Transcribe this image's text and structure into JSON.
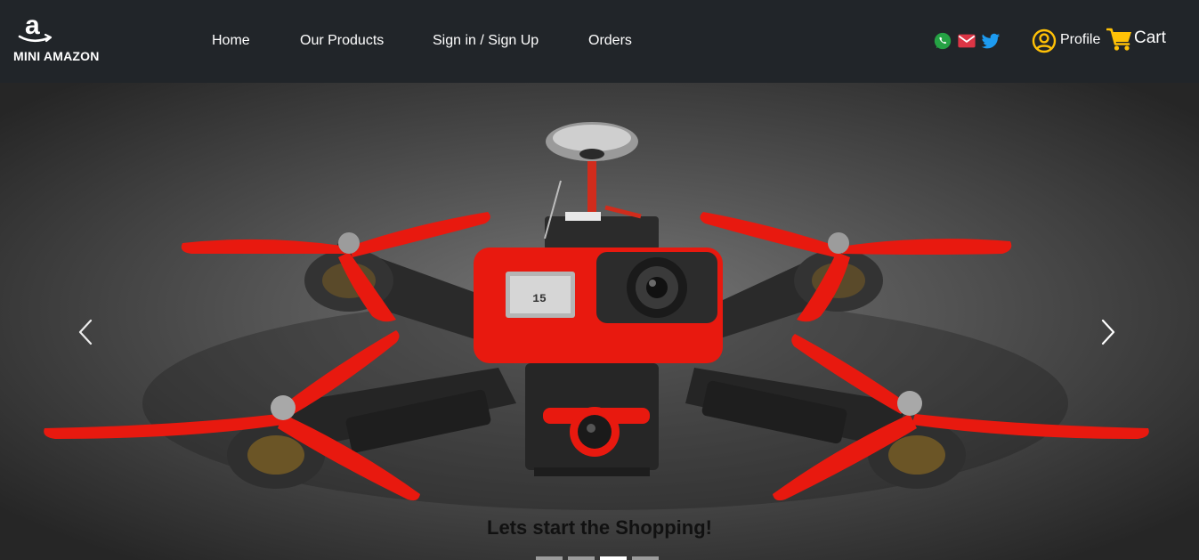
{
  "brand": {
    "name": "MINI AMAZON",
    "logo_icon": "amazon-logo-icon"
  },
  "nav": {
    "items": [
      {
        "label": "Home"
      },
      {
        "label": "Our Products"
      },
      {
        "label": "Sign in / Sign Up"
      },
      {
        "label": "Orders"
      }
    ]
  },
  "social": {
    "whatsapp_icon": "whatsapp-icon",
    "mail_icon": "mail-icon",
    "twitter_icon": "twitter-icon",
    "colors": {
      "whatsapp": "#25a244",
      "mail": "#dc3545",
      "twitter": "#1d9bf0"
    }
  },
  "profile": {
    "label": "Profile",
    "icon": "user-circle-icon"
  },
  "cart": {
    "label": "Cart",
    "icon": "shopping-cart-icon"
  },
  "colors": {
    "navbar": "#212529",
    "accent": "#ffc107",
    "drone": "#e8190f"
  },
  "carousel": {
    "caption": "Lets start the Shopping!",
    "slide_count": 4,
    "active_slide": 2,
    "prev_icon": "chevron-left-icon",
    "next_icon": "chevron-right-icon",
    "image": "red-fpv-drone-image"
  }
}
